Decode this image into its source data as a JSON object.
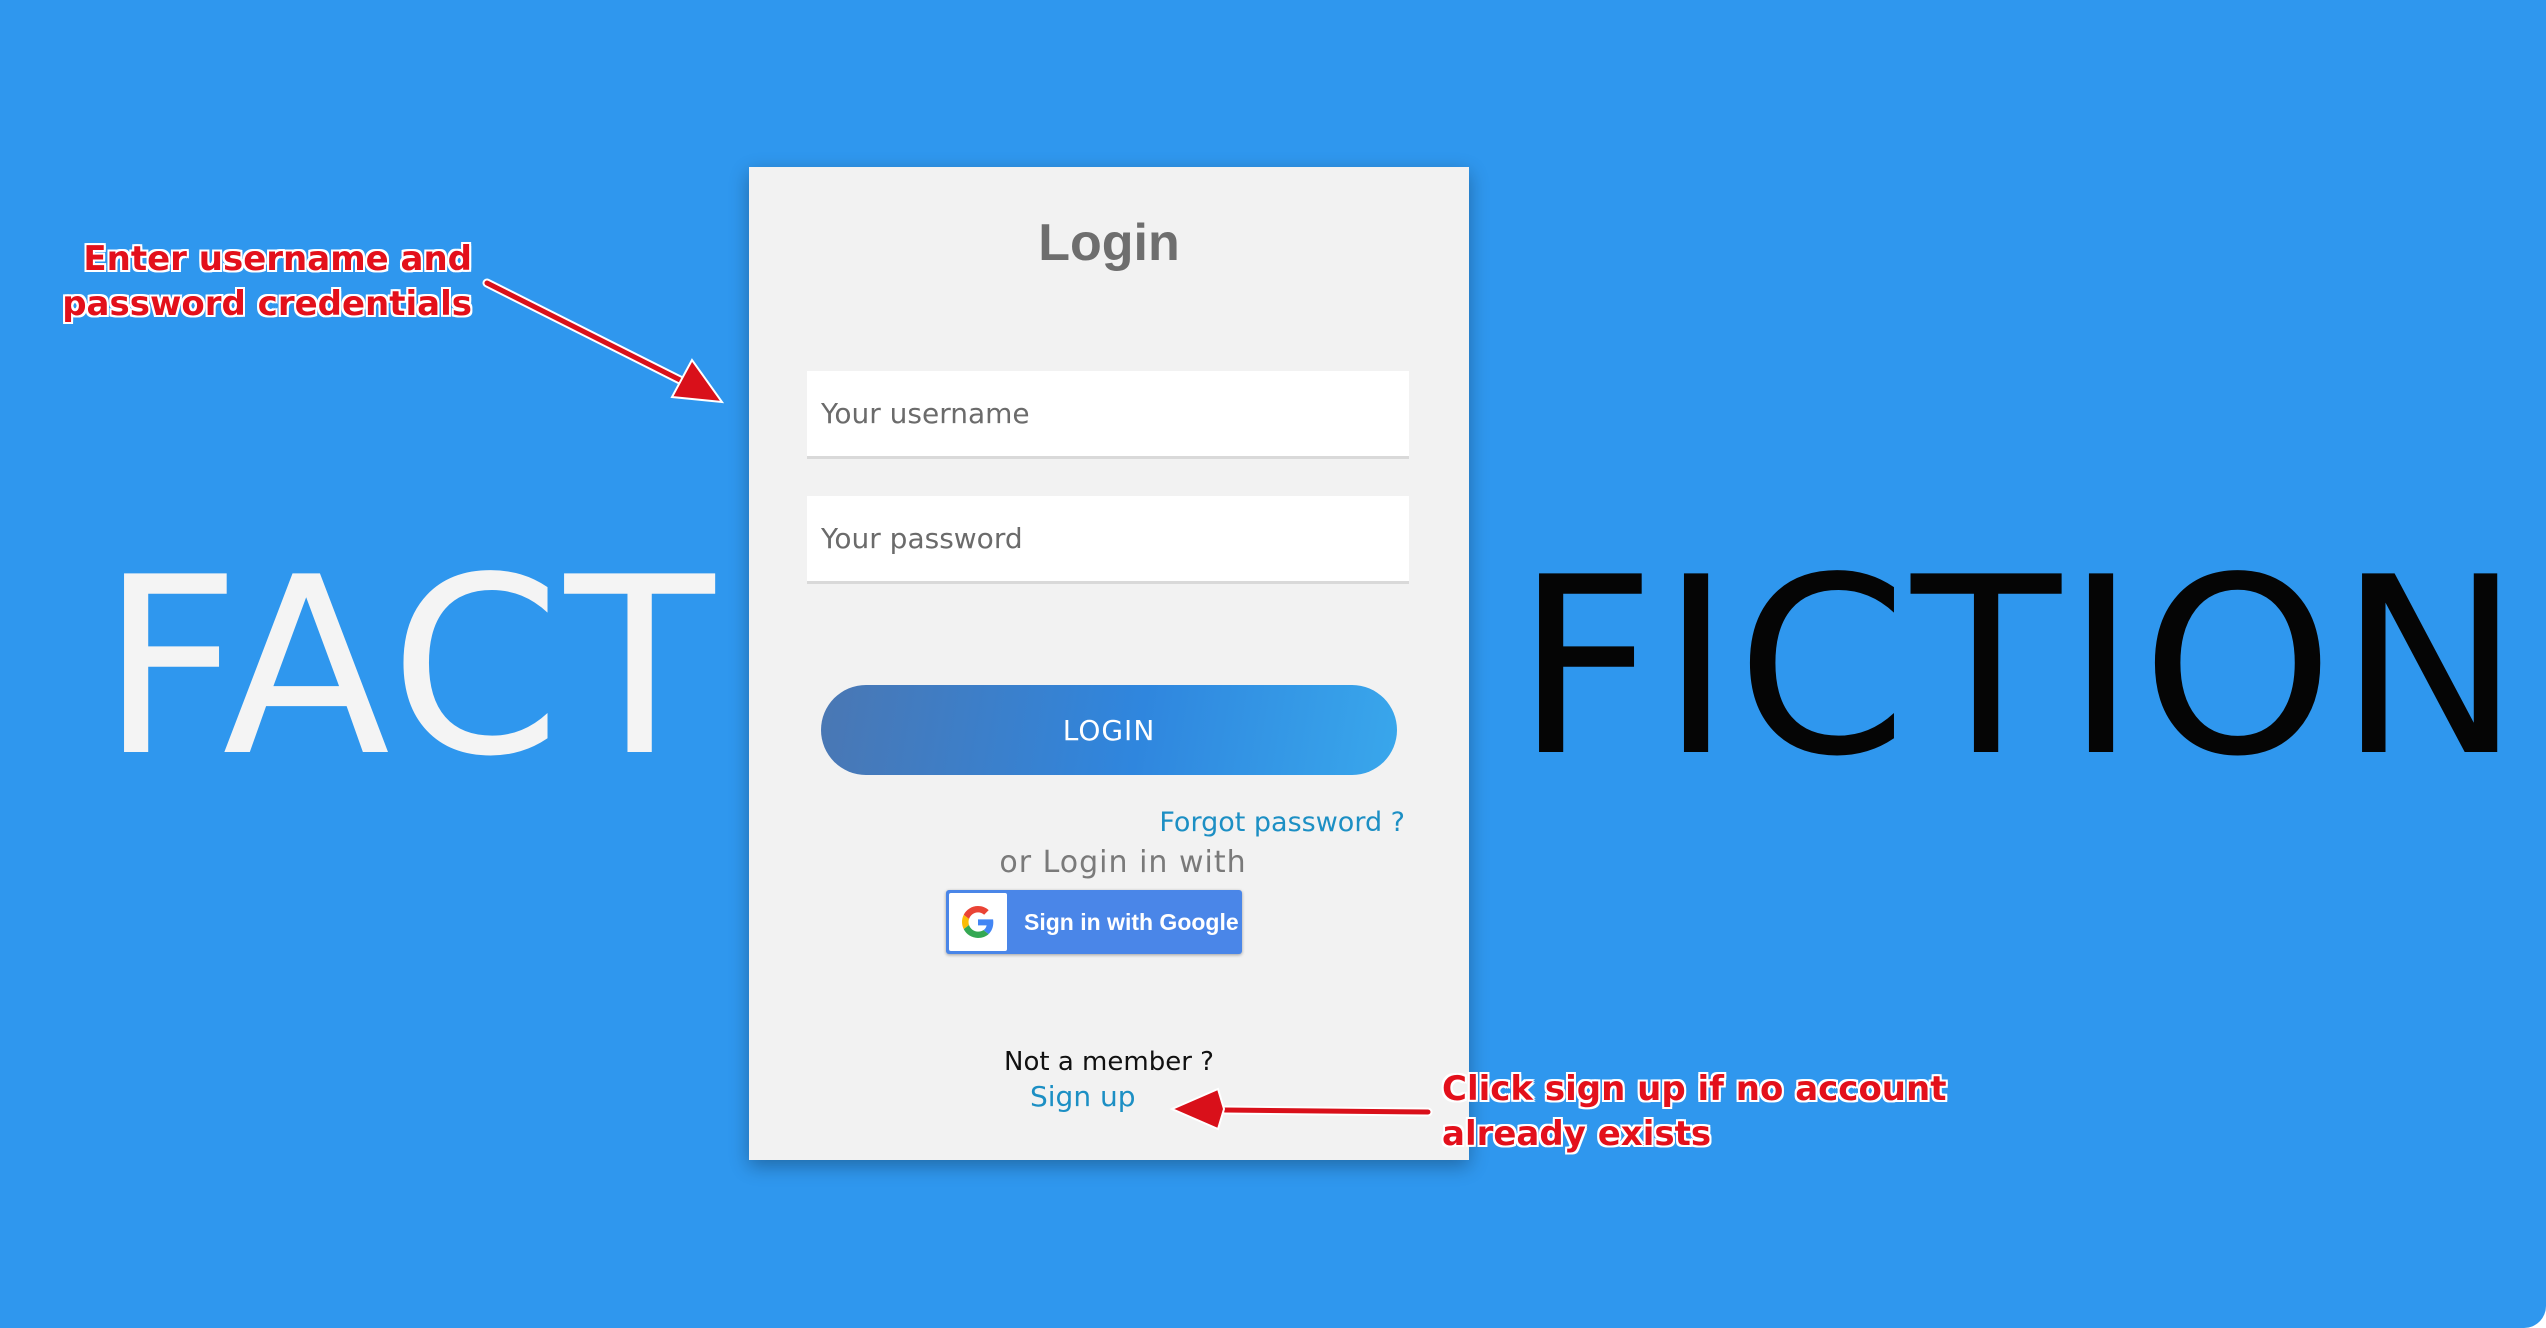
{
  "background": {
    "left_word": "FACT",
    "right_word": "FICTION",
    "colors": {
      "background": "#2f97ee",
      "left_word": "#f4f4f4",
      "right_word": "#050505"
    }
  },
  "login_card": {
    "title": "Login",
    "username_placeholder": "Your username",
    "password_placeholder": "Your password",
    "login_button_label": "LOGIN",
    "forgot_password_label": "Forgot password ?",
    "or_login_text": "or Login in with",
    "google_button_label": "Sign in with Google",
    "google_icon": "google-g-icon",
    "not_member_text": "Not a member ?",
    "signup_label": "Sign up",
    "colors": {
      "card": "#f2f2f2",
      "link": "#1c8fc4",
      "google_button": "#4a86e8"
    }
  },
  "annotations": {
    "credentials_note": [
      "Enter username and",
      "password credentials"
    ],
    "signup_note": [
      "Click sign up if no account",
      "already exists"
    ],
    "color": "#e3101b"
  }
}
